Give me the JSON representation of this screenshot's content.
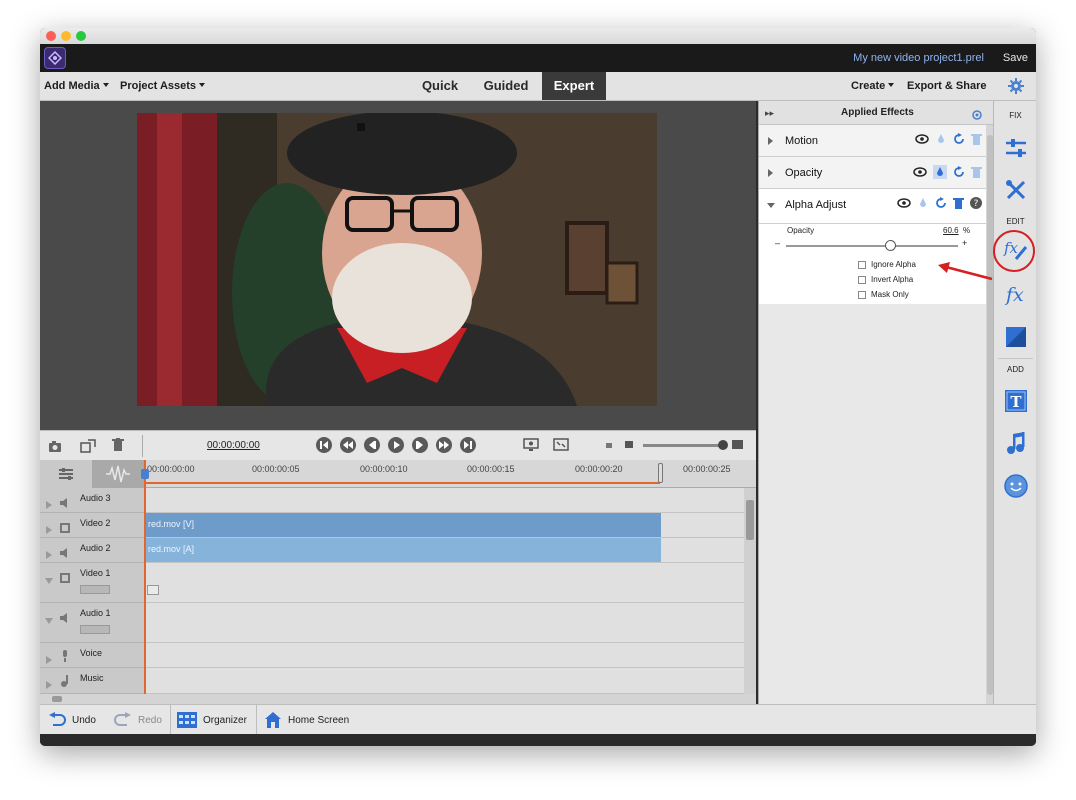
{
  "app": {
    "project_title": "My new video project1.prel",
    "save_label": "Save"
  },
  "menubar": {
    "add_media": "Add Media",
    "project_assets": "Project Assets",
    "modes": [
      "Quick",
      "Guided",
      "Expert"
    ],
    "active_mode": "Expert",
    "create": "Create",
    "export_share": "Export & Share"
  },
  "controls": {
    "timecode": "00:00:00:00"
  },
  "ruler": {
    "ticks": [
      "00:00:00:00",
      "00:00:00:05",
      "00:00:00:10",
      "00:00:00:15",
      "00:00:00:20",
      "00:00:00:25"
    ]
  },
  "tracks": [
    {
      "name": "Audio 3",
      "kind": "audio"
    },
    {
      "name": "Video 2",
      "kind": "video",
      "clip": "red.mov [V]"
    },
    {
      "name": "Audio 2",
      "kind": "audio",
      "clip": "red.mov [A]"
    },
    {
      "name": "Video 1",
      "kind": "video"
    },
    {
      "name": "Audio 1",
      "kind": "audio"
    },
    {
      "name": "Voice",
      "kind": "voice"
    },
    {
      "name": "Music",
      "kind": "music"
    }
  ],
  "bottombar": {
    "undo": "Undo",
    "redo": "Redo",
    "organizer": "Organizer",
    "home_screen": "Home Screen"
  },
  "effects_panel": {
    "title": "Applied Effects",
    "effects": [
      {
        "name": "Motion"
      },
      {
        "name": "Opacity"
      },
      {
        "name": "Alpha Adjust"
      }
    ],
    "alpha_adjust": {
      "opacity_label": "Opacity",
      "opacity_value": "60.6",
      "opacity_unit": "%",
      "opacity_fraction": 0.606,
      "minus": "–",
      "plus": "+",
      "options": [
        "Ignore Alpha",
        "Invert Alpha",
        "Mask Only"
      ]
    }
  },
  "sidebar": {
    "fix_label": "FIX",
    "edit_label": "EDIT",
    "add_label": "ADD"
  },
  "colors": {
    "clip_video": "#6d9ccb",
    "clip_audio": "#86b3da",
    "playhead": "#e2662f",
    "accent_blue": "#2f6fd1",
    "annotation_red": "#d42020"
  }
}
